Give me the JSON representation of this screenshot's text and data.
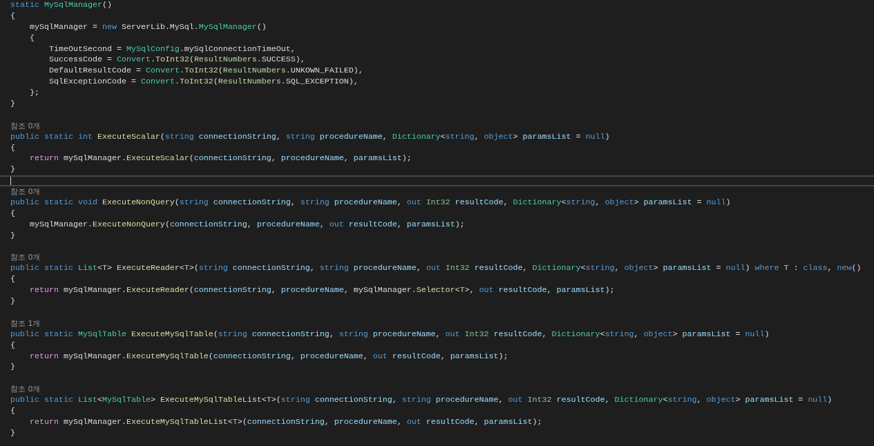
{
  "editor": {
    "lines": [
      {
        "kind": "code",
        "selected": false,
        "tokens": [
          {
            "text": "static ",
            "kind": "keyword"
          },
          {
            "text": "MySqlManager",
            "kind": "class"
          },
          {
            "text": "()",
            "kind": "plain"
          }
        ]
      },
      {
        "kind": "code",
        "selected": false,
        "tokens": [
          {
            "text": "{",
            "kind": "plain"
          }
        ]
      },
      {
        "kind": "code",
        "selected": false,
        "tokens": [
          {
            "text": "    mySqlManager = ",
            "kind": "plain"
          },
          {
            "text": "new ",
            "kind": "keyword"
          },
          {
            "text": "ServerLib.MySql.",
            "kind": "plain"
          },
          {
            "text": "MySqlManager",
            "kind": "class"
          },
          {
            "text": "()",
            "kind": "plain"
          }
        ]
      },
      {
        "kind": "code",
        "selected": false,
        "tokens": [
          {
            "text": "    {",
            "kind": "plain"
          }
        ]
      },
      {
        "kind": "code",
        "selected": false,
        "tokens": [
          {
            "text": "        TimeOutSecond = ",
            "kind": "plain"
          },
          {
            "text": "MySqlConfig",
            "kind": "class"
          },
          {
            "text": ".mySqlConnectionTimeOut,",
            "kind": "plain"
          }
        ]
      },
      {
        "kind": "code",
        "selected": false,
        "tokens": [
          {
            "text": "        SuccessCode = ",
            "kind": "plain"
          },
          {
            "text": "Convert",
            "kind": "class"
          },
          {
            "text": ".",
            "kind": "plain"
          },
          {
            "text": "ToInt32",
            "kind": "method"
          },
          {
            "text": "(",
            "kind": "plain"
          },
          {
            "text": "ResultNumbers",
            "kind": "enum"
          },
          {
            "text": ".SUCCESS),",
            "kind": "plain"
          }
        ]
      },
      {
        "kind": "code",
        "selected": false,
        "tokens": [
          {
            "text": "        DefaultResultCode = ",
            "kind": "plain"
          },
          {
            "text": "Convert",
            "kind": "class"
          },
          {
            "text": ".",
            "kind": "plain"
          },
          {
            "text": "ToInt32",
            "kind": "method"
          },
          {
            "text": "(",
            "kind": "plain"
          },
          {
            "text": "ResultNumbers",
            "kind": "enum"
          },
          {
            "text": ".UNKOWN_FAILED),",
            "kind": "plain"
          }
        ]
      },
      {
        "kind": "code",
        "selected": false,
        "tokens": [
          {
            "text": "        SqlExceptionCode = ",
            "kind": "plain"
          },
          {
            "text": "Convert",
            "kind": "class"
          },
          {
            "text": ".",
            "kind": "plain"
          },
          {
            "text": "ToInt32",
            "kind": "method"
          },
          {
            "text": "(",
            "kind": "plain"
          },
          {
            "text": "ResultNumbers",
            "kind": "enum"
          },
          {
            "text": ".SQL_EXCEPTION),",
            "kind": "plain"
          }
        ]
      },
      {
        "kind": "code",
        "selected": false,
        "tokens": [
          {
            "text": "    };",
            "kind": "plain"
          }
        ]
      },
      {
        "kind": "code",
        "selected": false,
        "tokens": [
          {
            "text": "}",
            "kind": "plain"
          }
        ]
      },
      {
        "kind": "blank",
        "selected": false
      },
      {
        "kind": "lens",
        "selected": false,
        "tokens": [
          {
            "text": "참조 0개",
            "kind": "lens"
          }
        ]
      },
      {
        "kind": "code",
        "selected": false,
        "tokens": [
          {
            "text": "public static int ",
            "kind": "keyword"
          },
          {
            "text": "ExecuteScalar",
            "kind": "method"
          },
          {
            "text": "(",
            "kind": "plain"
          },
          {
            "text": "string ",
            "kind": "keyword"
          },
          {
            "text": "connectionString",
            "kind": "param"
          },
          {
            "text": ", ",
            "kind": "plain"
          },
          {
            "text": "string ",
            "kind": "keyword"
          },
          {
            "text": "procedureName",
            "kind": "param"
          },
          {
            "text": ", ",
            "kind": "plain"
          },
          {
            "text": "Dictionary",
            "kind": "class"
          },
          {
            "text": "<",
            "kind": "plain"
          },
          {
            "text": "string",
            "kind": "keyword"
          },
          {
            "text": ", ",
            "kind": "plain"
          },
          {
            "text": "object",
            "kind": "keyword"
          },
          {
            "text": "> ",
            "kind": "plain"
          },
          {
            "text": "paramsList",
            "kind": "param"
          },
          {
            "text": " = ",
            "kind": "plain"
          },
          {
            "text": "null",
            "kind": "keyword"
          },
          {
            "text": ")",
            "kind": "plain"
          }
        ]
      },
      {
        "kind": "code",
        "selected": false,
        "tokens": [
          {
            "text": "{",
            "kind": "plain"
          }
        ]
      },
      {
        "kind": "code",
        "selected": false,
        "tokens": [
          {
            "text": "    return ",
            "kind": "control"
          },
          {
            "text": "mySqlManager.",
            "kind": "plain"
          },
          {
            "text": "ExecuteScalar",
            "kind": "method"
          },
          {
            "text": "(",
            "kind": "plain"
          },
          {
            "text": "connectionString",
            "kind": "param"
          },
          {
            "text": ", ",
            "kind": "plain"
          },
          {
            "text": "procedureName",
            "kind": "param"
          },
          {
            "text": ", ",
            "kind": "plain"
          },
          {
            "text": "paramsList",
            "kind": "param"
          },
          {
            "text": ");",
            "kind": "plain"
          }
        ]
      },
      {
        "kind": "code",
        "selected": false,
        "tokens": [
          {
            "text": "}",
            "kind": "plain"
          }
        ]
      },
      {
        "kind": "blank",
        "selected": true
      },
      {
        "kind": "lens",
        "selected": false,
        "tokens": [
          {
            "text": "참조 0개",
            "kind": "lens"
          }
        ]
      },
      {
        "kind": "code",
        "selected": false,
        "tokens": [
          {
            "text": "public static void ",
            "kind": "keyword"
          },
          {
            "text": "ExecuteNonQuery",
            "kind": "method"
          },
          {
            "text": "(",
            "kind": "plain"
          },
          {
            "text": "string ",
            "kind": "keyword"
          },
          {
            "text": "connectionString",
            "kind": "param"
          },
          {
            "text": ", ",
            "kind": "plain"
          },
          {
            "text": "string ",
            "kind": "keyword"
          },
          {
            "text": "procedureName",
            "kind": "param"
          },
          {
            "text": ", ",
            "kind": "plain"
          },
          {
            "text": "out ",
            "kind": "keyword"
          },
          {
            "text": "Int32 ",
            "kind": "struct"
          },
          {
            "text": "resultCode",
            "kind": "param"
          },
          {
            "text": ", ",
            "kind": "plain"
          },
          {
            "text": "Dictionary",
            "kind": "class"
          },
          {
            "text": "<",
            "kind": "plain"
          },
          {
            "text": "string",
            "kind": "keyword"
          },
          {
            "text": ", ",
            "kind": "plain"
          },
          {
            "text": "object",
            "kind": "keyword"
          },
          {
            "text": "> ",
            "kind": "plain"
          },
          {
            "text": "paramsList",
            "kind": "param"
          },
          {
            "text": " = ",
            "kind": "plain"
          },
          {
            "text": "null",
            "kind": "keyword"
          },
          {
            "text": ")",
            "kind": "plain"
          }
        ]
      },
      {
        "kind": "code",
        "selected": false,
        "tokens": [
          {
            "text": "{",
            "kind": "plain"
          }
        ]
      },
      {
        "kind": "code",
        "selected": false,
        "tokens": [
          {
            "text": "    mySqlManager.",
            "kind": "plain"
          },
          {
            "text": "ExecuteNonQuery",
            "kind": "method"
          },
          {
            "text": "(",
            "kind": "plain"
          },
          {
            "text": "connectionString",
            "kind": "param"
          },
          {
            "text": ", ",
            "kind": "plain"
          },
          {
            "text": "procedureName",
            "kind": "param"
          },
          {
            "text": ", ",
            "kind": "plain"
          },
          {
            "text": "out ",
            "kind": "keyword"
          },
          {
            "text": "resultCode",
            "kind": "param"
          },
          {
            "text": ", ",
            "kind": "plain"
          },
          {
            "text": "paramsList",
            "kind": "param"
          },
          {
            "text": ");",
            "kind": "plain"
          }
        ]
      },
      {
        "kind": "code",
        "selected": false,
        "tokens": [
          {
            "text": "}",
            "kind": "plain"
          }
        ]
      },
      {
        "kind": "blank",
        "selected": false
      },
      {
        "kind": "lens",
        "selected": false,
        "tokens": [
          {
            "text": "참조 0개",
            "kind": "lens"
          }
        ]
      },
      {
        "kind": "code",
        "selected": false,
        "tokens": [
          {
            "text": "public static ",
            "kind": "keyword"
          },
          {
            "text": "List",
            "kind": "class"
          },
          {
            "text": "<",
            "kind": "plain"
          },
          {
            "text": "T",
            "kind": "enum"
          },
          {
            "text": "> ",
            "kind": "plain"
          },
          {
            "text": "ExecuteReader",
            "kind": "method"
          },
          {
            "text": "<",
            "kind": "plain"
          },
          {
            "text": "T",
            "kind": "enum"
          },
          {
            "text": ">(",
            "kind": "plain"
          },
          {
            "text": "string ",
            "kind": "keyword"
          },
          {
            "text": "connectionString",
            "kind": "param"
          },
          {
            "text": ", ",
            "kind": "plain"
          },
          {
            "text": "string ",
            "kind": "keyword"
          },
          {
            "text": "procedureName",
            "kind": "param"
          },
          {
            "text": ", ",
            "kind": "plain"
          },
          {
            "text": "out ",
            "kind": "keyword"
          },
          {
            "text": "Int32 ",
            "kind": "struct"
          },
          {
            "text": "resultCode",
            "kind": "param"
          },
          {
            "text": ", ",
            "kind": "plain"
          },
          {
            "text": "Dictionary",
            "kind": "class"
          },
          {
            "text": "<",
            "kind": "plain"
          },
          {
            "text": "string",
            "kind": "keyword"
          },
          {
            "text": ", ",
            "kind": "plain"
          },
          {
            "text": "object",
            "kind": "keyword"
          },
          {
            "text": "> ",
            "kind": "plain"
          },
          {
            "text": "paramsList",
            "kind": "param"
          },
          {
            "text": " = ",
            "kind": "plain"
          },
          {
            "text": "null",
            "kind": "keyword"
          },
          {
            "text": ") ",
            "kind": "plain"
          },
          {
            "text": "where ",
            "kind": "keyword"
          },
          {
            "text": "T",
            "kind": "enum"
          },
          {
            "text": " : ",
            "kind": "plain"
          },
          {
            "text": "class",
            "kind": "keyword"
          },
          {
            "text": ", ",
            "kind": "plain"
          },
          {
            "text": "new",
            "kind": "keyword"
          },
          {
            "text": "()",
            "kind": "plain"
          }
        ]
      },
      {
        "kind": "code",
        "selected": false,
        "tokens": [
          {
            "text": "{",
            "kind": "plain"
          }
        ]
      },
      {
        "kind": "code",
        "selected": false,
        "tokens": [
          {
            "text": "    return ",
            "kind": "control"
          },
          {
            "text": "mySqlManager.",
            "kind": "plain"
          },
          {
            "text": "ExecuteReader",
            "kind": "method"
          },
          {
            "text": "(",
            "kind": "plain"
          },
          {
            "text": "connectionString",
            "kind": "param"
          },
          {
            "text": ", ",
            "kind": "plain"
          },
          {
            "text": "procedureName",
            "kind": "param"
          },
          {
            "text": ", mySqlManager.",
            "kind": "plain"
          },
          {
            "text": "Selector",
            "kind": "method"
          },
          {
            "text": "<",
            "kind": "plain"
          },
          {
            "text": "T",
            "kind": "enum"
          },
          {
            "text": ">, ",
            "kind": "plain"
          },
          {
            "text": "out ",
            "kind": "keyword"
          },
          {
            "text": "resultCode",
            "kind": "param"
          },
          {
            "text": ", ",
            "kind": "plain"
          },
          {
            "text": "paramsList",
            "kind": "param"
          },
          {
            "text": ");",
            "kind": "plain"
          }
        ]
      },
      {
        "kind": "code",
        "selected": false,
        "tokens": [
          {
            "text": "}",
            "kind": "plain"
          }
        ]
      },
      {
        "kind": "blank",
        "selected": false
      },
      {
        "kind": "lens",
        "selected": false,
        "tokens": [
          {
            "text": "참조 1개",
            "kind": "lens"
          }
        ]
      },
      {
        "kind": "code",
        "selected": false,
        "tokens": [
          {
            "text": "public static ",
            "kind": "keyword"
          },
          {
            "text": "MySqlTable ",
            "kind": "class"
          },
          {
            "text": "ExecuteMySqlTable",
            "kind": "method"
          },
          {
            "text": "(",
            "kind": "plain"
          },
          {
            "text": "string ",
            "kind": "keyword"
          },
          {
            "text": "connectionString",
            "kind": "param"
          },
          {
            "text": ", ",
            "kind": "plain"
          },
          {
            "text": "string ",
            "kind": "keyword"
          },
          {
            "text": "procedureName",
            "kind": "param"
          },
          {
            "text": ", ",
            "kind": "plain"
          },
          {
            "text": "out ",
            "kind": "keyword"
          },
          {
            "text": "Int32 ",
            "kind": "struct"
          },
          {
            "text": "resultCode",
            "kind": "param"
          },
          {
            "text": ", ",
            "kind": "plain"
          },
          {
            "text": "Dictionary",
            "kind": "class"
          },
          {
            "text": "<",
            "kind": "plain"
          },
          {
            "text": "string",
            "kind": "keyword"
          },
          {
            "text": ", ",
            "kind": "plain"
          },
          {
            "text": "object",
            "kind": "keyword"
          },
          {
            "text": "> ",
            "kind": "plain"
          },
          {
            "text": "paramsList",
            "kind": "param"
          },
          {
            "text": " = ",
            "kind": "plain"
          },
          {
            "text": "null",
            "kind": "keyword"
          },
          {
            "text": ")",
            "kind": "plain"
          }
        ]
      },
      {
        "kind": "code",
        "selected": false,
        "tokens": [
          {
            "text": "{",
            "kind": "plain"
          }
        ]
      },
      {
        "kind": "code",
        "selected": false,
        "tokens": [
          {
            "text": "    return ",
            "kind": "control"
          },
          {
            "text": "mySqlManager.",
            "kind": "plain"
          },
          {
            "text": "ExecuteMySqlTable",
            "kind": "method"
          },
          {
            "text": "(",
            "kind": "plain"
          },
          {
            "text": "connectionString",
            "kind": "param"
          },
          {
            "text": ", ",
            "kind": "plain"
          },
          {
            "text": "procedureName",
            "kind": "param"
          },
          {
            "text": ", ",
            "kind": "plain"
          },
          {
            "text": "out ",
            "kind": "keyword"
          },
          {
            "text": "resultCode",
            "kind": "param"
          },
          {
            "text": ", ",
            "kind": "plain"
          },
          {
            "text": "paramsList",
            "kind": "param"
          },
          {
            "text": ");",
            "kind": "plain"
          }
        ]
      },
      {
        "kind": "code",
        "selected": false,
        "tokens": [
          {
            "text": "}",
            "kind": "plain"
          }
        ]
      },
      {
        "kind": "blank",
        "selected": false
      },
      {
        "kind": "lens",
        "selected": false,
        "tokens": [
          {
            "text": "참조 0개",
            "kind": "lens"
          }
        ]
      },
      {
        "kind": "code",
        "selected": false,
        "tokens": [
          {
            "text": "public static ",
            "kind": "keyword"
          },
          {
            "text": "List",
            "kind": "class"
          },
          {
            "text": "<",
            "kind": "plain"
          },
          {
            "text": "MySqlTable",
            "kind": "class"
          },
          {
            "text": "> ",
            "kind": "plain"
          },
          {
            "text": "ExecuteMySqlTableList",
            "kind": "method"
          },
          {
            "text": "<",
            "kind": "plain"
          },
          {
            "text": "T",
            "kind": "enum"
          },
          {
            "text": ">(",
            "kind": "plain"
          },
          {
            "text": "string ",
            "kind": "keyword"
          },
          {
            "text": "connectionString",
            "kind": "param"
          },
          {
            "text": ", ",
            "kind": "plain"
          },
          {
            "text": "string ",
            "kind": "keyword"
          },
          {
            "text": "procedureName",
            "kind": "param"
          },
          {
            "text": ", ",
            "kind": "plain"
          },
          {
            "text": "out ",
            "kind": "keyword"
          },
          {
            "text": "Int32 ",
            "kind": "struct"
          },
          {
            "text": "resultCode",
            "kind": "param"
          },
          {
            "text": ", ",
            "kind": "plain"
          },
          {
            "text": "Dictionary",
            "kind": "class"
          },
          {
            "text": "<",
            "kind": "plain"
          },
          {
            "text": "string",
            "kind": "keyword"
          },
          {
            "text": ", ",
            "kind": "plain"
          },
          {
            "text": "object",
            "kind": "keyword"
          },
          {
            "text": "> ",
            "kind": "plain"
          },
          {
            "text": "paramsList",
            "kind": "param"
          },
          {
            "text": " = ",
            "kind": "plain"
          },
          {
            "text": "null",
            "kind": "keyword"
          },
          {
            "text": ")",
            "kind": "plain"
          }
        ]
      },
      {
        "kind": "code",
        "selected": false,
        "tokens": [
          {
            "text": "{",
            "kind": "plain"
          }
        ]
      },
      {
        "kind": "code",
        "selected": false,
        "tokens": [
          {
            "text": "    return ",
            "kind": "control"
          },
          {
            "text": "mySqlManager.",
            "kind": "plain"
          },
          {
            "text": "ExecuteMySqlTableList",
            "kind": "method"
          },
          {
            "text": "<",
            "kind": "plain"
          },
          {
            "text": "T",
            "kind": "enum"
          },
          {
            "text": ">(",
            "kind": "plain"
          },
          {
            "text": "connectionString",
            "kind": "param"
          },
          {
            "text": ", ",
            "kind": "plain"
          },
          {
            "text": "procedureName",
            "kind": "param"
          },
          {
            "text": ", ",
            "kind": "plain"
          },
          {
            "text": "out ",
            "kind": "keyword"
          },
          {
            "text": "resultCode",
            "kind": "param"
          },
          {
            "text": ", ",
            "kind": "plain"
          },
          {
            "text": "paramsList",
            "kind": "param"
          },
          {
            "text": ");",
            "kind": "plain"
          }
        ]
      },
      {
        "kind": "code",
        "selected": false,
        "tokens": [
          {
            "text": "}",
            "kind": "plain"
          }
        ]
      }
    ]
  }
}
